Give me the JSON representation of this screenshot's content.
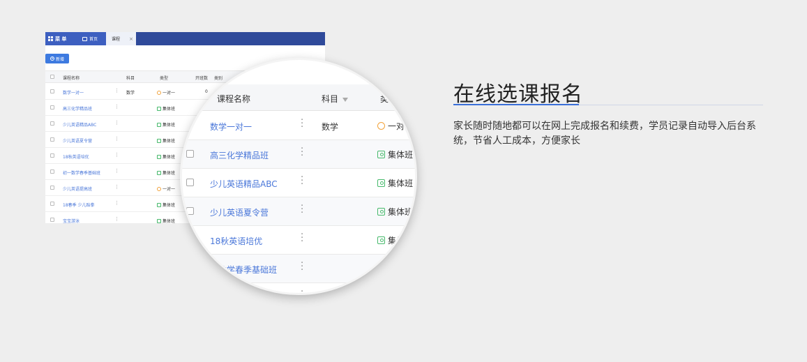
{
  "app": {
    "menu_label": "菜 单",
    "tabs": [
      {
        "label": "首页"
      },
      {
        "label": "课程",
        "close": "×"
      }
    ],
    "add_button": "新增",
    "table": {
      "columns": [
        "课程名称",
        "科目",
        "类型",
        "开班数",
        "类别"
      ],
      "rows": [
        {
          "name": "数学一对一",
          "subject": "数学",
          "type": "一对一",
          "type_icon": "person-icon",
          "count": "0"
        },
        {
          "name": "高三化学精品班",
          "subject": "",
          "type": "集体班",
          "type_icon": "group-icon",
          "count": ""
        },
        {
          "name": "少儿英语精品ABC",
          "subject": "",
          "type": "集体班",
          "type_icon": "group-icon",
          "count": ""
        },
        {
          "name": "少儿英语夏令营",
          "subject": "",
          "type": "集体班",
          "type_icon": "group-icon",
          "count": ""
        },
        {
          "name": "18秋英语培优",
          "subject": "",
          "type": "集体班",
          "type_icon": "group-icon",
          "count": ""
        },
        {
          "name": "初一数学春季基础班",
          "subject": "",
          "type": "集体班",
          "type_icon": "group-icon",
          "count": ""
        },
        {
          "name": "少儿英语提高班",
          "subject": "",
          "type": "一对一",
          "type_icon": "person-icon",
          "count": ""
        },
        {
          "name": "18春季 少儿跆拳",
          "subject": "",
          "type": "集体班",
          "type_icon": "group-icon",
          "count": ""
        },
        {
          "name": "宝宝游泳",
          "subject": "",
          "type": "集体班",
          "type_icon": "group-icon",
          "count": ""
        }
      ]
    }
  },
  "magnifier": {
    "columns": [
      "课程名称",
      "科目",
      "类"
    ],
    "rows": [
      {
        "name": "数学一对一",
        "subject": "数学",
        "type": "一对一"
      },
      {
        "name": "高三化学精品班",
        "subject": "",
        "type": "集体班"
      },
      {
        "name": "少儿英语精品ABC",
        "subject": "",
        "type": "集体班"
      },
      {
        "name": "少儿英语夏令营",
        "subject": "",
        "type": "集体班"
      },
      {
        "name": "18秋英语培优",
        "subject": "",
        "type": "集体班"
      },
      {
        "name": "一数学春季基础班",
        "subject": "",
        "type": ""
      }
    ]
  },
  "feature": {
    "title": "在线选课报名",
    "description": "家长随时随地都可以在网上完成报名和续费，学员记录自动导入后台系统，节省人工成本，方便家长"
  },
  "colors": {
    "topbar": "#2f4a9a",
    "accent": "#3a6fd8",
    "link": "#4a77d9",
    "group_icon": "#46b96b",
    "person_icon": "#f2a23a"
  }
}
